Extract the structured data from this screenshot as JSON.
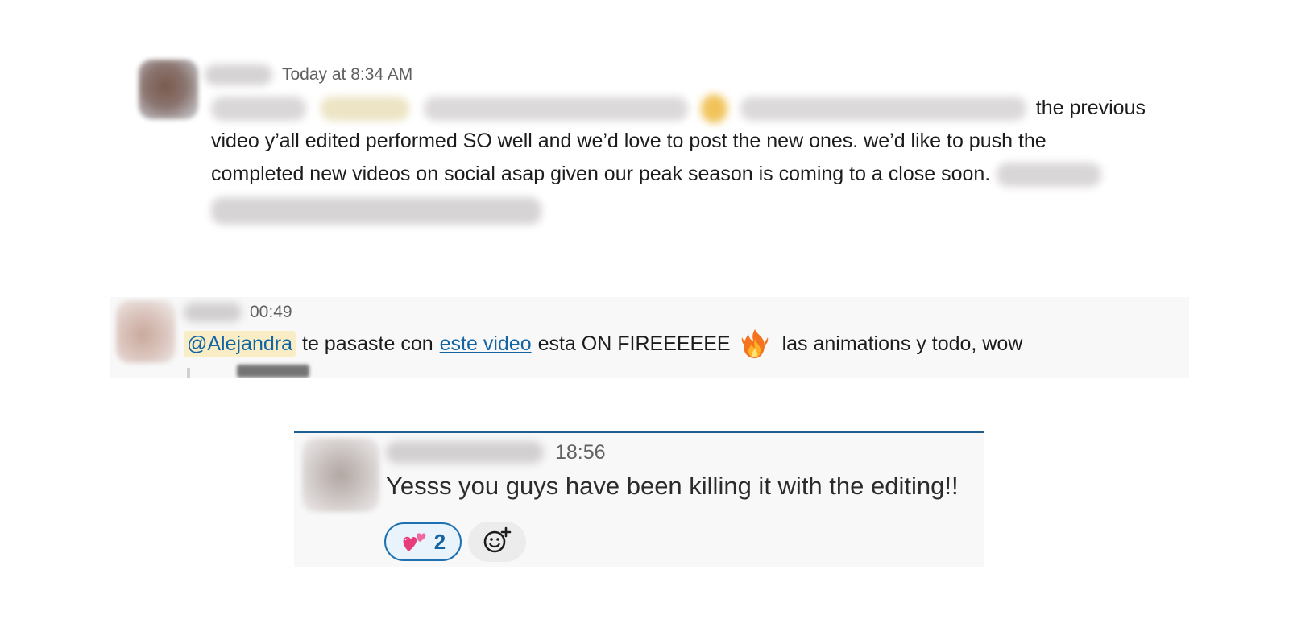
{
  "messages": [
    {
      "timestamp": "Today at 8:34 AM",
      "text_line1": "the previous",
      "text_line2": "video y’all edited performed SO well and we’d love to post the new ones. we’d like to push the",
      "text_line3": "completed new videos on social asap given our peak season is coming to a close soon."
    },
    {
      "timestamp": "00:49",
      "mention": "@Alejandra",
      "text_before_link": "te pasaste con",
      "link_text": "este video",
      "text_after_link": "esta ON FIREEEEEE",
      "emoji": "fire-icon",
      "text_end": "las animations y todo, wow"
    },
    {
      "timestamp": "18:56",
      "text": "Yesss you guys have been killing it with the editing!!",
      "reactions": [
        {
          "emoji": "two-hearts-icon",
          "count": "2",
          "selected": true
        }
      ],
      "add_reaction_icon": "add-reaction-icon"
    }
  ],
  "colors": {
    "link": "#1264a3",
    "mention_bg": "#f9edc6",
    "reaction_border": "#1d71b0",
    "highlight_border": "#1d5e92",
    "muted_text": "#616061"
  }
}
